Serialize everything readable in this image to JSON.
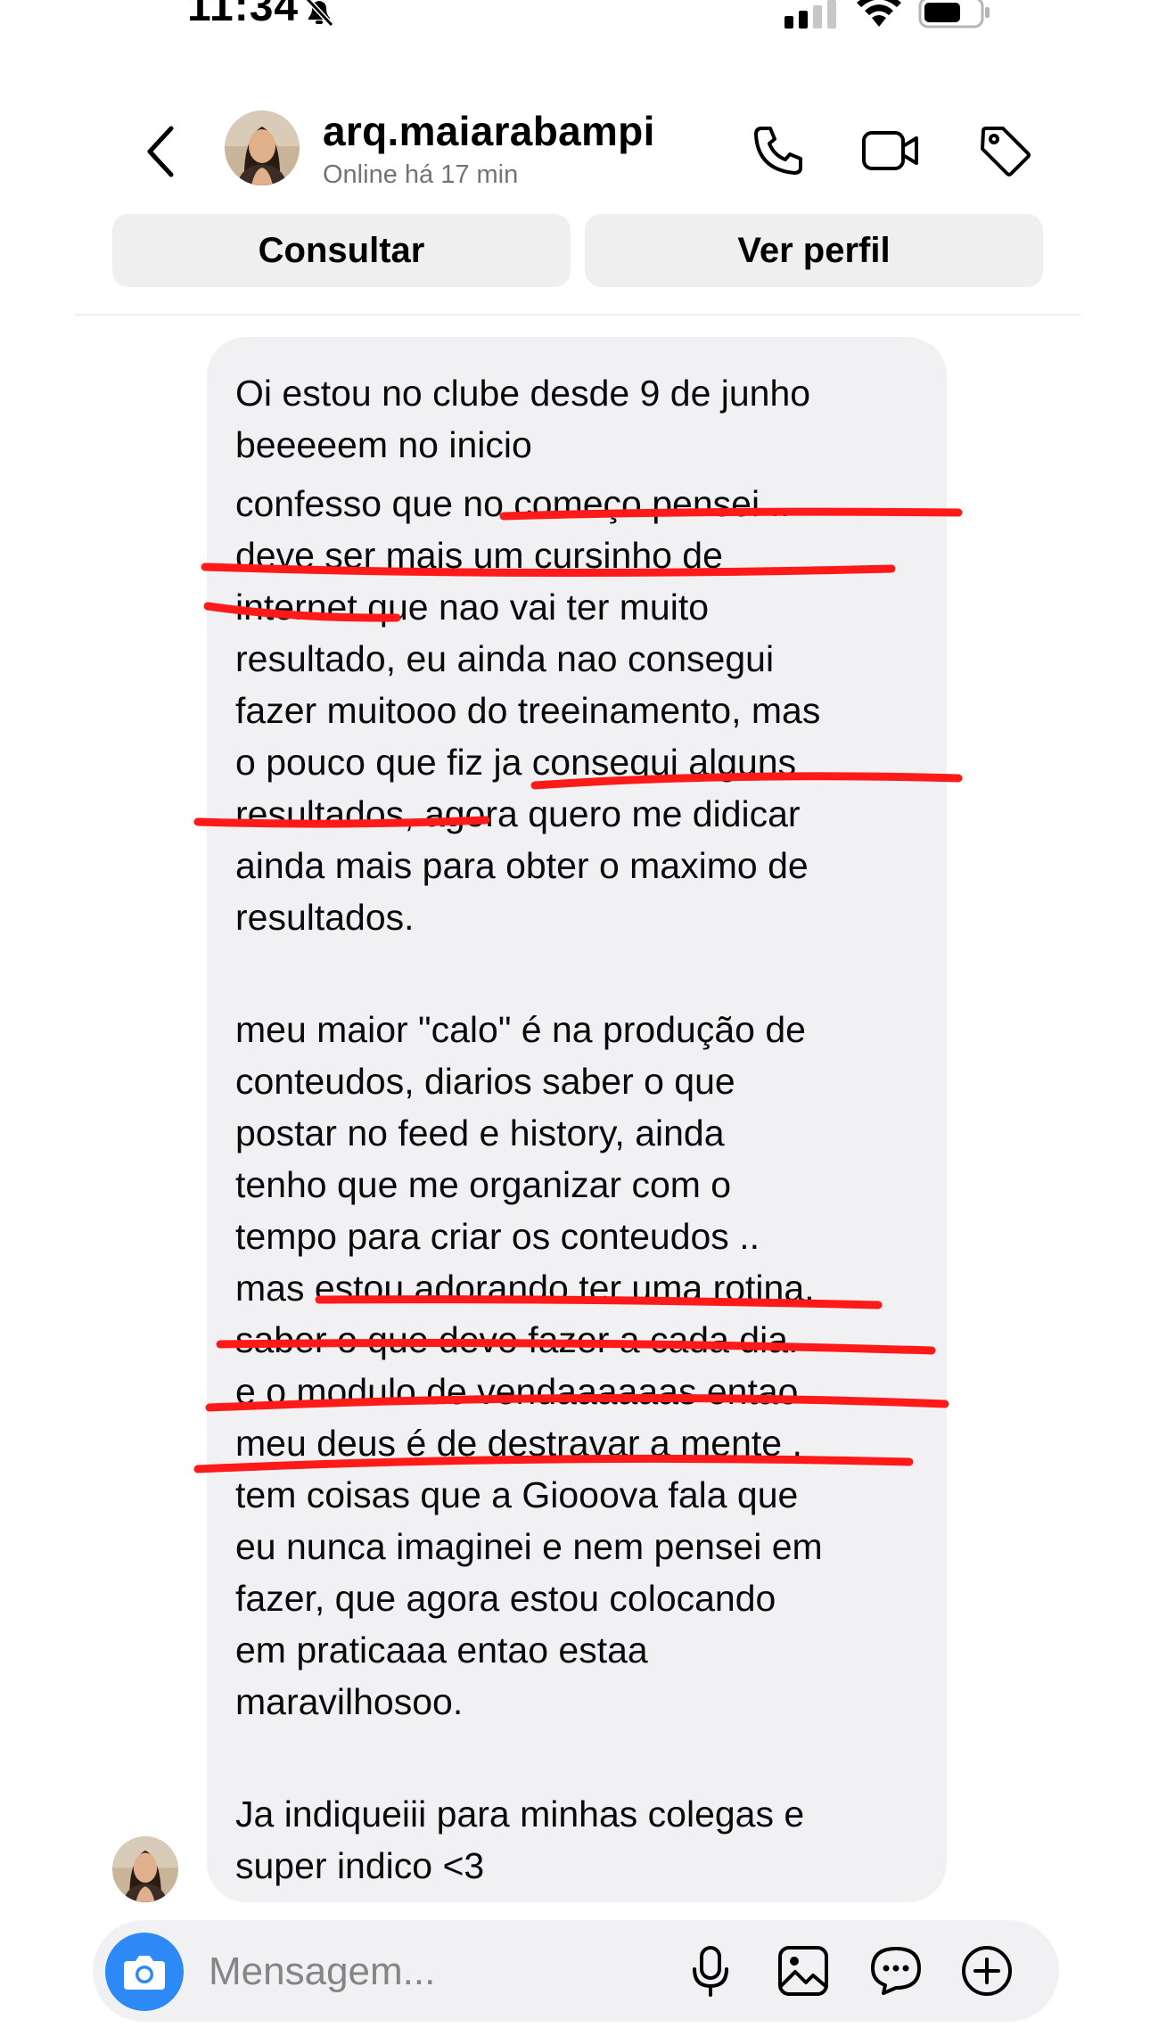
{
  "status_bar": {
    "time": "11:34"
  },
  "header": {
    "username": "arq.maiarabampi",
    "status": "Online há 17 min"
  },
  "actions": {
    "consult": "Consultar",
    "profile": "Ver perfil"
  },
  "message": {
    "paragraphs": [
      [
        "Oi estou no clube desde 9 de junho",
        "beeeeem no inicio",
        "confesso que no começo pensei ..",
        "deve ser mais um cursinho de",
        "internet que nao vai ter muito",
        "resultado, eu ainda nao consegui",
        "fazer muitooo do treeinamento, mas",
        "o pouco que fiz ja consegui alguns",
        "resultados, agora quero me didicar",
        "ainda mais para obter o maximo de",
        "resultados."
      ],
      [
        "meu maior \"calo\" é na produção de",
        "conteudos, diarios saber o que",
        "postar no feed e history, ainda",
        "tenho que me organizar com o",
        "tempo para criar os conteudos ..",
        "mas estou adorando ter uma rotina,",
        "saber o que devo fazer a cada dia.",
        "e o modulo de vendaaaaaas entao",
        "meu deus é de destravar a mente ,",
        "tem coisas que a Giooova fala que",
        "eu nunca imaginei e nem pensei em",
        "fazer, que agora estou colocando",
        "em praticaaa entao estaa",
        "maravilhosoo."
      ],
      [
        "Ja indiqueiii para minhas colegas e",
        "super indico <3"
      ]
    ]
  },
  "composer": {
    "placeholder": "Mensagem..."
  },
  "colors": {
    "accent": "#2d89f5",
    "annotation": "#ff1a1a",
    "bubble": "#f1f1f3"
  },
  "icons": [
    "bell-slash-icon",
    "signal-icon",
    "wifi-icon",
    "battery-icon",
    "back-icon",
    "phone-icon",
    "video-icon",
    "tag-icon",
    "camera-icon",
    "mic-icon",
    "gallery-icon",
    "sticker-icon",
    "plus-icon"
  ]
}
